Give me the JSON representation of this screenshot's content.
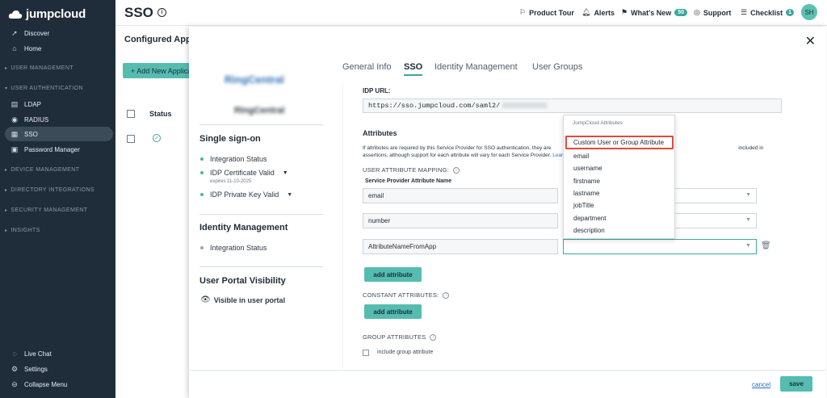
{
  "brand": {
    "name": "jumpcloud"
  },
  "sidebar": {
    "top_items": [
      {
        "label": "Discover",
        "icon": "rocket-icon"
      },
      {
        "label": "Home",
        "icon": "home-icon"
      }
    ],
    "sections": [
      {
        "label": "USER MANAGEMENT"
      },
      {
        "label": "USER AUTHENTICATION"
      },
      {
        "label": "DEVICE MANAGEMENT"
      },
      {
        "label": "DIRECTORY INTEGRATIONS"
      },
      {
        "label": "SECURITY MANAGEMENT"
      },
      {
        "label": "INSIGHTS"
      }
    ],
    "auth_items": [
      {
        "label": "LDAP",
        "icon": "ldap-icon"
      },
      {
        "label": "RADIUS",
        "icon": "radius-icon"
      },
      {
        "label": "SSO",
        "icon": "grid-icon",
        "active": true
      },
      {
        "label": "Password Manager",
        "icon": "password-manager-icon"
      }
    ],
    "bottom_items": [
      {
        "label": "Live Chat",
        "icon": "chat-icon"
      },
      {
        "label": "Settings",
        "icon": "gear-icon"
      },
      {
        "label": "Collapse Menu",
        "icon": "collapse-icon"
      }
    ]
  },
  "header": {
    "title": "SSO",
    "product_tour": "Product Tour",
    "alerts": "Alerts",
    "whats_new": "What's New",
    "whats_new_count": "50",
    "support": "Support",
    "checklist": "Checklist",
    "checklist_count": "1",
    "avatar_initials": "SH"
  },
  "underlying": {
    "title": "Configured Apps",
    "add_button": "+ Add New Application",
    "status_col": "Status"
  },
  "modal": {
    "app_logo_text": "RingCentral",
    "app_name": "RingCentral",
    "tabs": [
      {
        "label": "General Info"
      },
      {
        "label": "SSO",
        "active": true
      },
      {
        "label": "Identity Management"
      },
      {
        "label": "User Groups"
      }
    ],
    "left": {
      "sso_title": "Single sign-on",
      "sso_items": [
        {
          "label": "Integration Status"
        },
        {
          "label": "IDP Certificate Valid",
          "dropdown": true,
          "note": "expires 11-10-2025"
        },
        {
          "label": "IDP Private Key Valid",
          "dropdown": true
        }
      ],
      "idm_title": "Identity Management",
      "idm_items": [
        {
          "label": "Integration Status"
        }
      ],
      "portal_title": "User Portal Visibility",
      "portal_item": "Visible in user portal"
    },
    "sso": {
      "idp_url_label": "IDP URL:",
      "idp_url_value": "https://sso.jumpcloud.com/saml2/",
      "attributes_title": "Attributes",
      "attributes_desc_1": "If attributes are required by this Service Provider for SSO authentication, they are ",
      "attributes_desc_2": "included in assertions, although support for each attribute will vary for each Service Provider. ",
      "learn_more": "Learn more.",
      "user_attr_mapping": "USER ATTRIBUTE MAPPING:",
      "sp_attr_name_header": "Service Provider Attribute Name",
      "mapping_rows": [
        {
          "sp_value": "email"
        },
        {
          "sp_value": "number"
        },
        {
          "sp_value": "AttributeNameFromApp"
        }
      ],
      "add_attribute": "add attribute",
      "constant_attributes": "CONSTANT ATTRIBUTES:",
      "add_attribute_2": "add attribute",
      "group_attributes": "GROUP ATTRIBUTES",
      "include_group_attribute": "include group attribute"
    },
    "dropdown": {
      "header": "JumpCloud Attributes",
      "highlighted": "Custom User or Group Attribute",
      "options": [
        "email",
        "username",
        "firstname",
        "lastname",
        "jobTitle",
        "department",
        "description"
      ]
    },
    "footer": {
      "cancel": "cancel",
      "save": "save"
    }
  },
  "colors": {
    "sidebar_bg": "#1f2d3a",
    "accent": "#55bdb0",
    "highlight_border": "#e04a3b"
  }
}
